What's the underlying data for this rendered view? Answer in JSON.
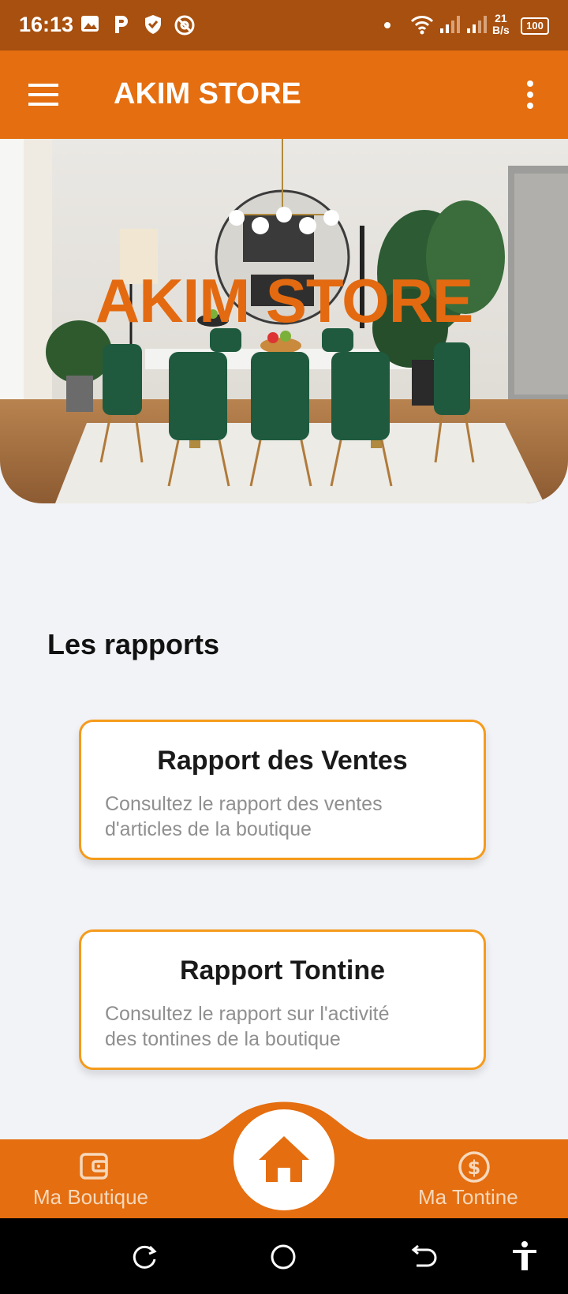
{
  "status_bar": {
    "time": "16:13",
    "net_speed_top": "21",
    "net_speed_bottom": "B/s",
    "battery": "100",
    "icons": [
      "image-icon",
      "parking-icon",
      "shield-icon",
      "at-icon",
      "dot-icon",
      "wifi-icon",
      "signal-icon",
      "signal-icon",
      "battery-icon"
    ]
  },
  "app_bar": {
    "title": "AKIM STORE",
    "menu_icon": "hamburger-menu-icon",
    "overflow_icon": "more-vertical-icon"
  },
  "hero": {
    "title": "AKIM STORE"
  },
  "reports": {
    "section_title": "Les rapports",
    "cards": [
      {
        "title": "Rapport des Ventes",
        "line1": "Consultez le rapport des ventes",
        "line2": "d'articles de la boutique"
      },
      {
        "title": "Rapport Tontine",
        "line1": "Consultez le rapport sur l'activité",
        "line2": "des tontines de la boutique"
      }
    ]
  },
  "bottom_nav": {
    "left_label": "Ma Boutique",
    "right_label": "Ma Tontine",
    "left_icon": "wallet-icon",
    "center_icon": "home-icon",
    "right_icon": "dollar-circle-icon"
  },
  "colors": {
    "primary": "#e46e10",
    "status_bar": "#a8500f",
    "card_border": "#f59b1b",
    "background": "#f2f3f7"
  }
}
